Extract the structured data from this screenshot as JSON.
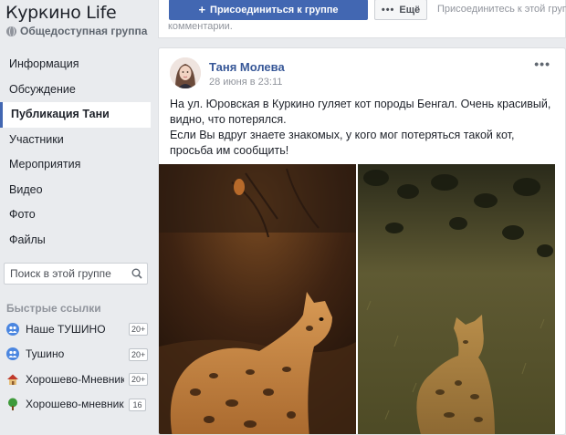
{
  "sidebar": {
    "group_title": "Куркино Life",
    "group_privacy": "Общедоступная группа",
    "nav": [
      {
        "label": "Информация",
        "active": false
      },
      {
        "label": "Обсуждение",
        "active": false
      },
      {
        "label": "Публикация Тани",
        "active": true
      },
      {
        "label": "Участники",
        "active": false
      },
      {
        "label": "Мероприятия",
        "active": false
      },
      {
        "label": "Видео",
        "active": false
      },
      {
        "label": "Фото",
        "active": false
      },
      {
        "label": "Файлы",
        "active": false
      }
    ],
    "search_placeholder": "Поиск в этой группе",
    "quick_links_title": "Быстрые ссылки",
    "quick_links": [
      {
        "label": "Наше ТУШИНО",
        "badge": "20+",
        "icon": "group-icon"
      },
      {
        "label": "Тушино",
        "badge": "20+",
        "icon": "group-icon"
      },
      {
        "label": "Хорошево-Мневники",
        "badge": "20+",
        "icon": "house-icon"
      },
      {
        "label": "Хорошево-мневники",
        "badge": "16",
        "icon": "tree-icon"
      }
    ]
  },
  "topbar": {
    "join_label": "Присоединиться к группе",
    "more_label": "Ещё",
    "join_hint": "Присоединитесь к этой группе",
    "comments_hint": "комментарии."
  },
  "post": {
    "author": "Таня Молева",
    "date": "28 июня в 23:11",
    "text_lines": [
      "На ул. Юровская в Куркино гуляет кот породы Бенгал. Очень красивый,",
      "видно, что потерялся.",
      "Если Вы вдруг знаете знакомых, у кого мог потеряться такой кот,",
      "просьба им сообщить!"
    ]
  },
  "colors": {
    "brand_blue": "#4267b2",
    "link_blue": "#385898",
    "page_bg": "#e9ebee"
  }
}
